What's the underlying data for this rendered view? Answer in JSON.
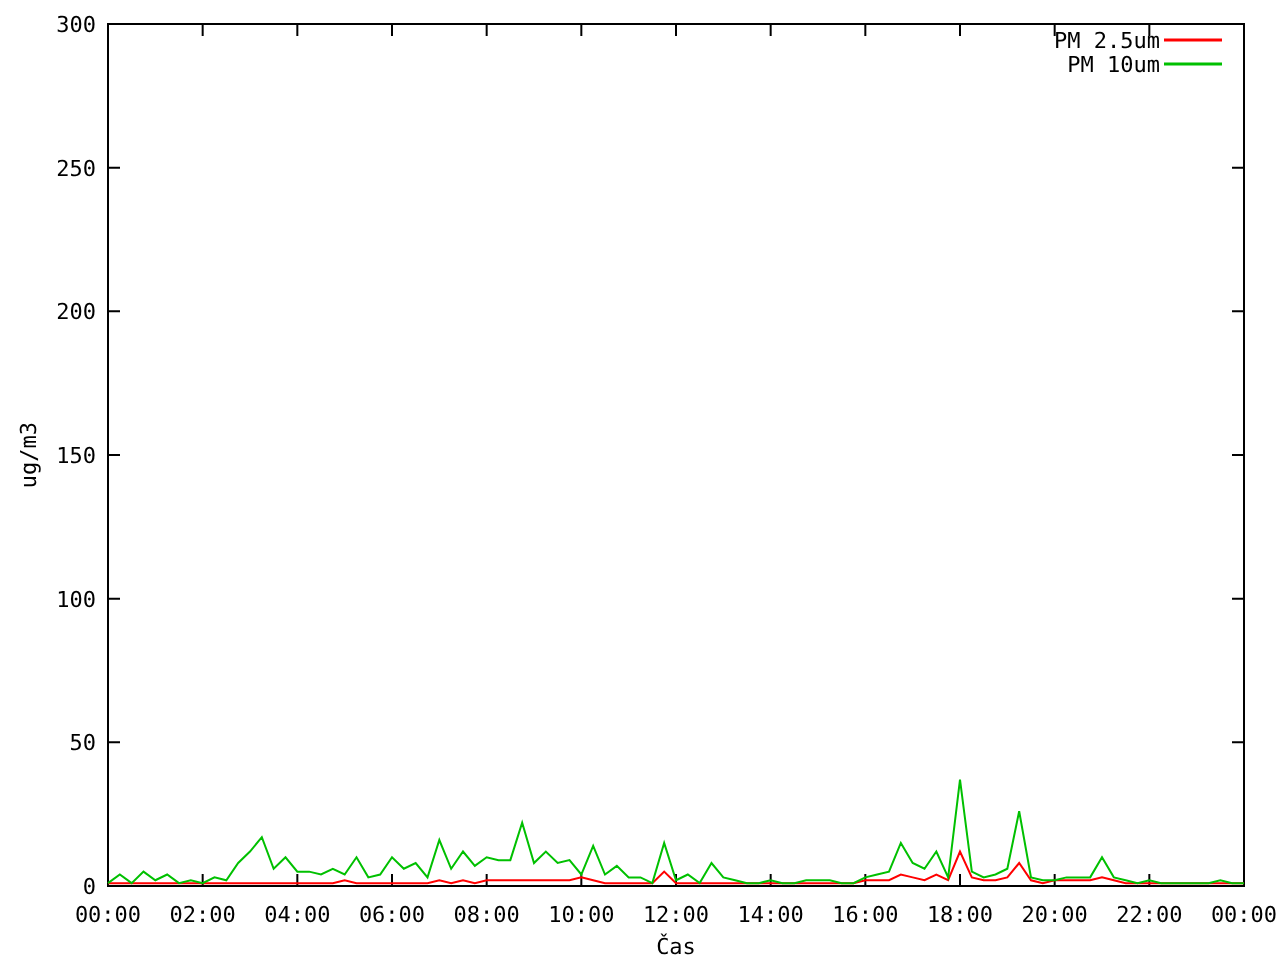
{
  "chart_data": {
    "type": "line",
    "legend": "top-right",
    "xlabel": "Čas",
    "ylabel": "ug/m3",
    "xlim": [
      0,
      24
    ],
    "ylim": [
      0,
      300
    ],
    "x": [
      0,
      0.25,
      0.5,
      0.75,
      1,
      1.25,
      1.5,
      1.75,
      2,
      2.25,
      2.5,
      2.75,
      3,
      3.25,
      3.5,
      3.75,
      4,
      4.25,
      4.5,
      4.75,
      5,
      5.25,
      5.5,
      5.75,
      6,
      6.25,
      6.5,
      6.75,
      7,
      7.25,
      7.5,
      7.75,
      8,
      8.25,
      8.5,
      8.75,
      9,
      9.25,
      9.5,
      9.75,
      10,
      10.25,
      10.5,
      10.75,
      11,
      11.25,
      11.5,
      11.75,
      12,
      12.25,
      12.5,
      12.75,
      13,
      13.25,
      13.5,
      13.75,
      14,
      14.25,
      14.5,
      14.75,
      15,
      15.25,
      15.5,
      15.75,
      16,
      16.25,
      16.5,
      16.75,
      17,
      17.25,
      17.5,
      17.75,
      18,
      18.25,
      18.5,
      18.75,
      19,
      19.25,
      19.5,
      19.75,
      20,
      20.25,
      20.5,
      20.75,
      21,
      21.25,
      21.5,
      21.75,
      22,
      22.25,
      22.5,
      22.75,
      23,
      23.25,
      23.5,
      23.75,
      24
    ],
    "xticks": [
      {
        "value": 0,
        "label": "00:00"
      },
      {
        "value": 2,
        "label": "02:00"
      },
      {
        "value": 4,
        "label": "04:00"
      },
      {
        "value": 6,
        "label": "06:00"
      },
      {
        "value": 8,
        "label": "08:00"
      },
      {
        "value": 10,
        "label": "10:00"
      },
      {
        "value": 12,
        "label": "12:00"
      },
      {
        "value": 14,
        "label": "14:00"
      },
      {
        "value": 16,
        "label": "16:00"
      },
      {
        "value": 18,
        "label": "18:00"
      },
      {
        "value": 20,
        "label": "20:00"
      },
      {
        "value": 22,
        "label": "22:00"
      },
      {
        "value": 24,
        "label": "00:00"
      }
    ],
    "yticks": [
      0,
      50,
      100,
      150,
      200,
      250,
      300
    ],
    "series": [
      {
        "name": "PM 2.5um",
        "color": "#ff0000",
        "values": [
          1,
          1,
          1,
          1,
          1,
          1,
          1,
          1,
          1,
          1,
          1,
          1,
          1,
          1,
          1,
          1,
          1,
          1,
          1,
          1,
          2,
          1,
          1,
          1,
          1,
          1,
          1,
          1,
          2,
          1,
          2,
          1,
          2,
          2,
          2,
          2,
          2,
          2,
          2,
          2,
          3,
          2,
          1,
          1,
          1,
          1,
          1,
          5,
          1,
          1,
          1,
          1,
          1,
          1,
          1,
          1,
          1,
          1,
          1,
          1,
          1,
          1,
          1,
          1,
          2,
          2,
          2,
          4,
          3,
          2,
          4,
          2,
          12,
          3,
          2,
          2,
          3,
          8,
          2,
          1,
          2,
          2,
          2,
          2,
          3,
          2,
          1,
          1,
          1,
          1,
          1,
          1,
          1,
          1,
          1,
          1,
          1
        ]
      },
      {
        "name": "PM 10um",
        "color": "#00c000",
        "values": [
          1,
          4,
          1,
          5,
          2,
          4,
          1,
          2,
          1,
          3,
          2,
          8,
          12,
          17,
          6,
          10,
          5,
          5,
          4,
          6,
          4,
          10,
          3,
          4,
          10,
          6,
          8,
          3,
          16,
          6,
          12,
          7,
          10,
          9,
          9,
          22,
          8,
          12,
          8,
          9,
          4,
          14,
          4,
          7,
          3,
          3,
          1,
          15,
          2,
          4,
          1,
          8,
          3,
          2,
          1,
          1,
          2,
          1,
          1,
          2,
          2,
          2,
          1,
          1,
          3,
          4,
          5,
          15,
          8,
          6,
          12,
          3,
          37,
          5,
          3,
          4,
          6,
          26,
          3,
          2,
          2,
          3,
          3,
          3,
          10,
          3,
          2,
          1,
          2,
          1,
          1,
          1,
          1,
          1,
          2,
          1,
          1
        ]
      }
    ]
  }
}
